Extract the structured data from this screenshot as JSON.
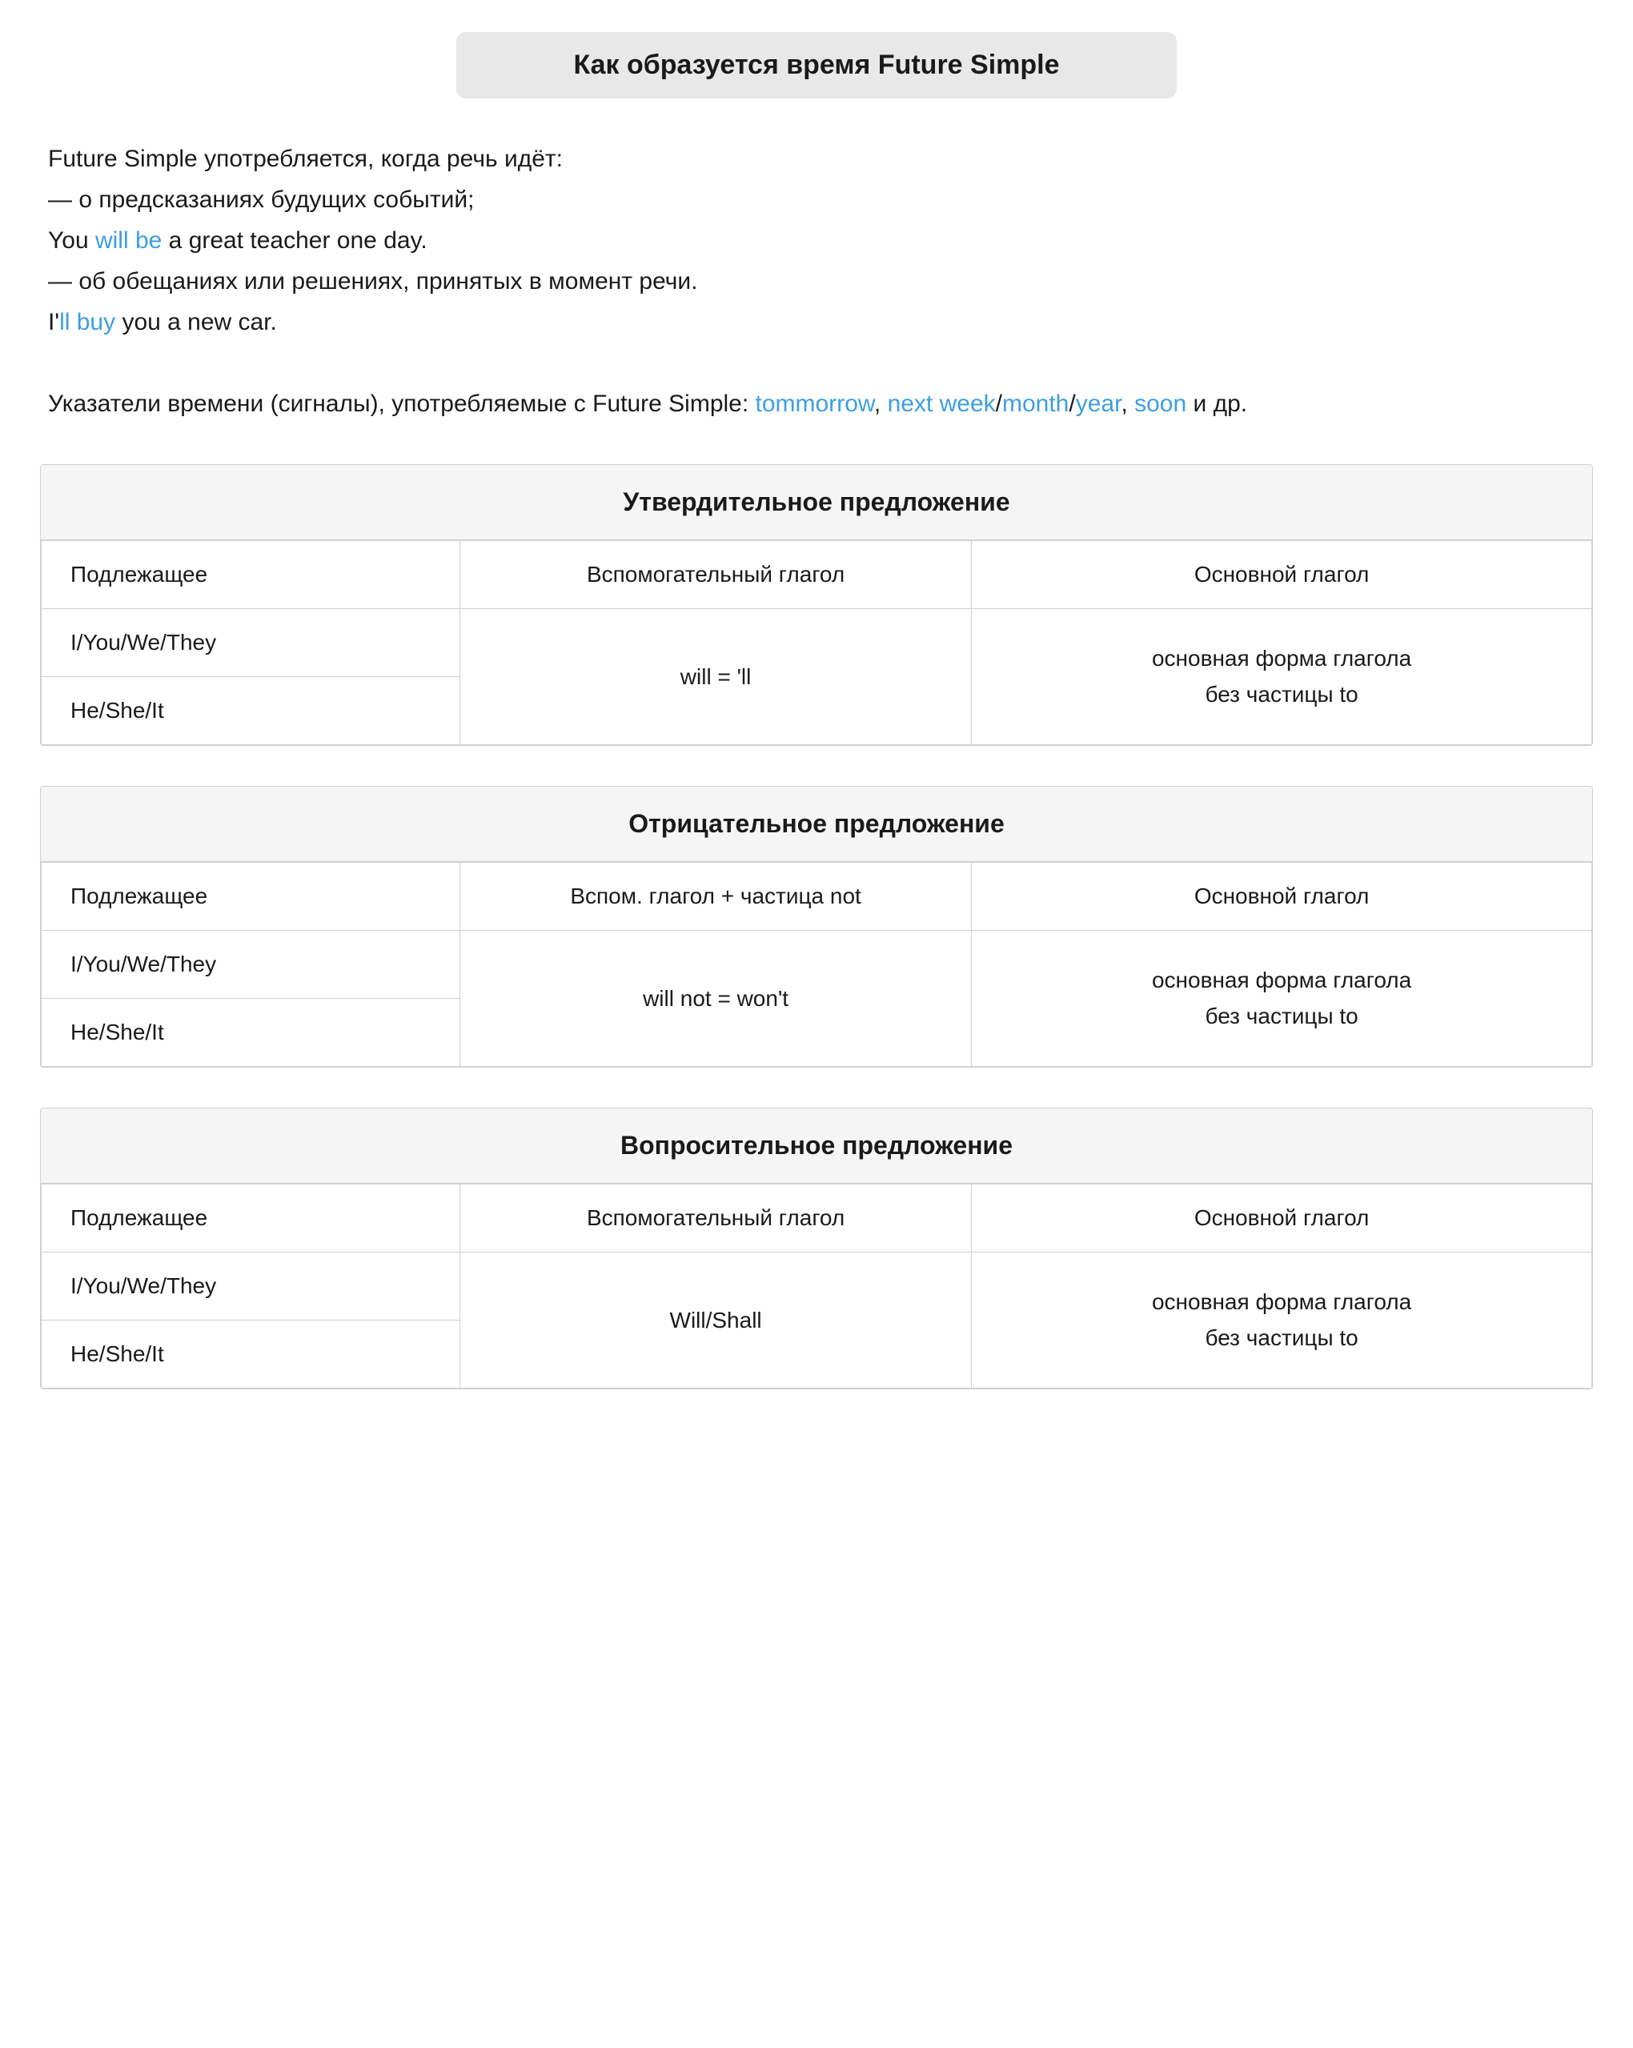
{
  "page": {
    "title": "Как образуется время Future Simple",
    "intro": {
      "line1": "Future Simple употребляется, когда речь идёт:",
      "line2": "— о предсказаниях будущих событий;",
      "line3_prefix": "You ",
      "line3_blue": "will be",
      "line3_suffix": " a great teacher one day.",
      "line4": "— об обещаниях или решениях, принятых в момент речи.",
      "line5_prefix": "I'",
      "line5_blue": "ll buy",
      "line5_suffix": " you a new car.",
      "line6_prefix": "Указатели времени (сигналы), употребляемые с Future Simple: ",
      "time_signals": [
        {
          "text": "tommorrow",
          "blue": true
        },
        {
          "text": ", "
        },
        {
          "text": "next week",
          "blue": true
        },
        {
          "text": "/"
        },
        {
          "text": "month",
          "blue": true
        },
        {
          "text": "/"
        },
        {
          "text": "year",
          "blue": true
        },
        {
          "text": ", "
        },
        {
          "text": "soon",
          "blue": true
        },
        {
          "text": " и др."
        }
      ]
    },
    "sections": [
      {
        "id": "affirmative",
        "header": "Утвердительное предложение",
        "col1": "Подлежащее",
        "col2": "Вспомогательный глагол",
        "col3": "Основной глагол",
        "subject1": "I/You/We/They",
        "subject2": "He/She/It",
        "aux": "will = 'll",
        "main": "основная форма глагола\nбез частицы to"
      },
      {
        "id": "negative",
        "header": "Отрицательное предложение",
        "col1": "Подлежащее",
        "col2": "Вспом. глагол + частица not",
        "col3": "Основной глагол",
        "subject1": "I/You/We/They",
        "subject2": "He/She/It",
        "aux": "will not = won't",
        "main": "основная форма глагола\nбез частицы to"
      },
      {
        "id": "interrogative",
        "header": "Вопросительное предложение",
        "col1": "Подлежащее",
        "col2": "Вспомогательный глагол",
        "col3": "Основной глагол",
        "subject1": "I/You/We/They",
        "subject2": "He/She/It",
        "aux": "Will/Shall",
        "main": "основная форма глагола\nбез частицы to"
      }
    ]
  }
}
